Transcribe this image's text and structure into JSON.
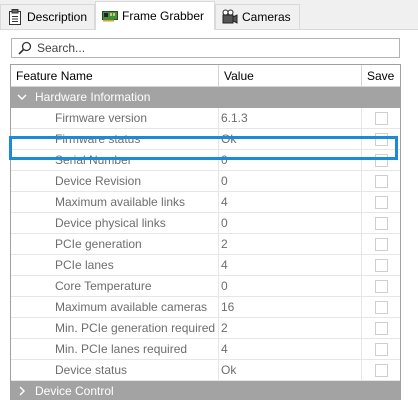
{
  "tabs": [
    {
      "label": "Description",
      "icon": "clipboard-icon",
      "active": false
    },
    {
      "label": "Frame Grabber",
      "icon": "frame-grabber-card-icon",
      "active": true
    },
    {
      "label": "Cameras",
      "icon": "cameras-icon",
      "active": false
    }
  ],
  "search": {
    "placeholder": "Search..."
  },
  "columns": {
    "feature": "Feature Name",
    "value": "Value",
    "save": "Save"
  },
  "groups": [
    {
      "label": "Hardware Information",
      "expanded": true
    },
    {
      "label": "Device Control",
      "expanded": false
    }
  ],
  "features": [
    {
      "name": "Firmware version",
      "value": "6.1.3",
      "save": false
    },
    {
      "name": "Firmware status",
      "value": "Ok",
      "save": false
    },
    {
      "name": "Serial Number",
      "value": "0",
      "save": false
    },
    {
      "name": "Device Revision",
      "value": "0",
      "save": false
    },
    {
      "name": "Maximum available links",
      "value": "4",
      "save": false
    },
    {
      "name": "Device physical links",
      "value": "0",
      "save": false
    },
    {
      "name": "PCIe generation",
      "value": "2",
      "save": false
    },
    {
      "name": "PCIe lanes",
      "value": "4",
      "save": false
    },
    {
      "name": "Core Temperature",
      "value": "0",
      "save": false
    },
    {
      "name": "Maximum available cameras",
      "value": "16",
      "save": false
    },
    {
      "name": "Min. PCIe generation required",
      "value": "2",
      "save": false
    },
    {
      "name": "Min. PCIe lanes required",
      "value": "4",
      "save": false
    },
    {
      "name": "Device status",
      "value": "Ok",
      "save": false
    }
  ],
  "colors": {
    "highlight": "#1a8bd6",
    "group_bg": "#a3a3a3"
  }
}
